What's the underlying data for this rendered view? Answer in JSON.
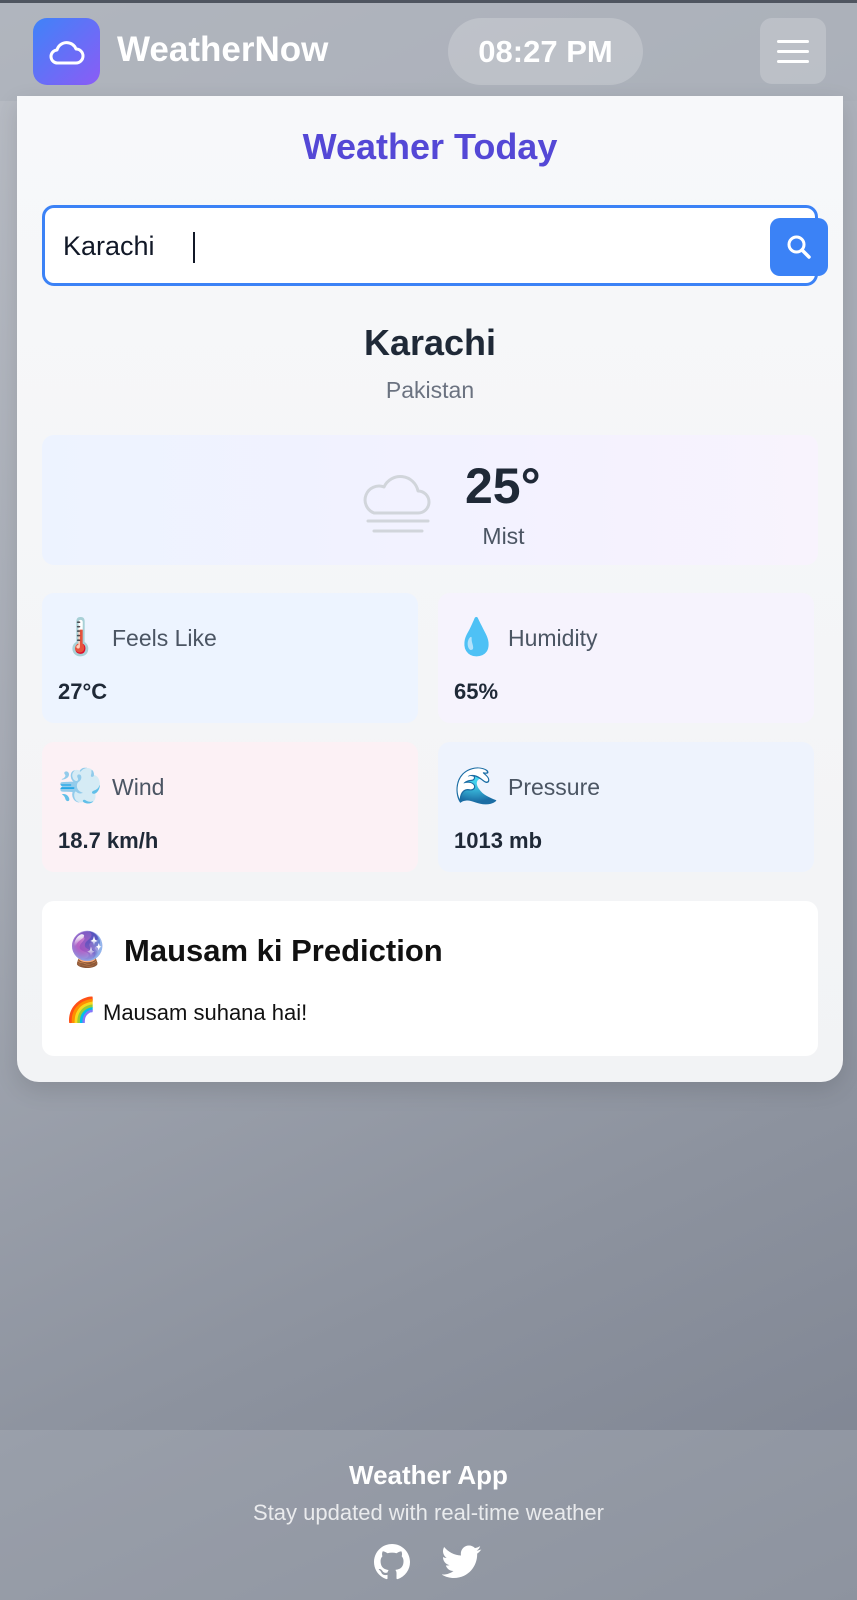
{
  "header": {
    "app_name": "WeatherNow",
    "time": "08:27 PM",
    "logo_icon": "cloud-icon",
    "menu_icon": "hamburger-menu-icon"
  },
  "card": {
    "title": "Weather Today",
    "search": {
      "value": "Karachi",
      "placeholder": "",
      "button_icon": "search-icon"
    },
    "location": {
      "city": "Karachi",
      "country": "Pakistan"
    },
    "current": {
      "temperature": "25°",
      "condition": "Mist",
      "condition_icon": "mist-icon"
    },
    "stats": [
      {
        "emoji": "🌡️",
        "label": "Feels Like",
        "value": "27°C"
      },
      {
        "emoji": "💧",
        "label": "Humidity",
        "value": "65%"
      },
      {
        "emoji": "💨",
        "label": "Wind",
        "value": "18.7 km/h"
      },
      {
        "emoji": "🌊",
        "label": "Pressure",
        "value": "1013 mb"
      }
    ],
    "prediction": {
      "emoji": "🔮",
      "title": "Mausam ki Prediction",
      "text_emoji": "🌈",
      "text": "Mausam suhana hai!"
    }
  },
  "footer": {
    "title": "Weather App",
    "subtitle": "Stay updated with real-time weather",
    "icons": [
      "github-icon",
      "twitter-icon"
    ]
  },
  "colors": {
    "accent": "#3b82f6",
    "title_purple": "#5448d6",
    "logo_gradient_start": "#3f83f8",
    "logo_gradient_end": "#8b5cf6"
  }
}
